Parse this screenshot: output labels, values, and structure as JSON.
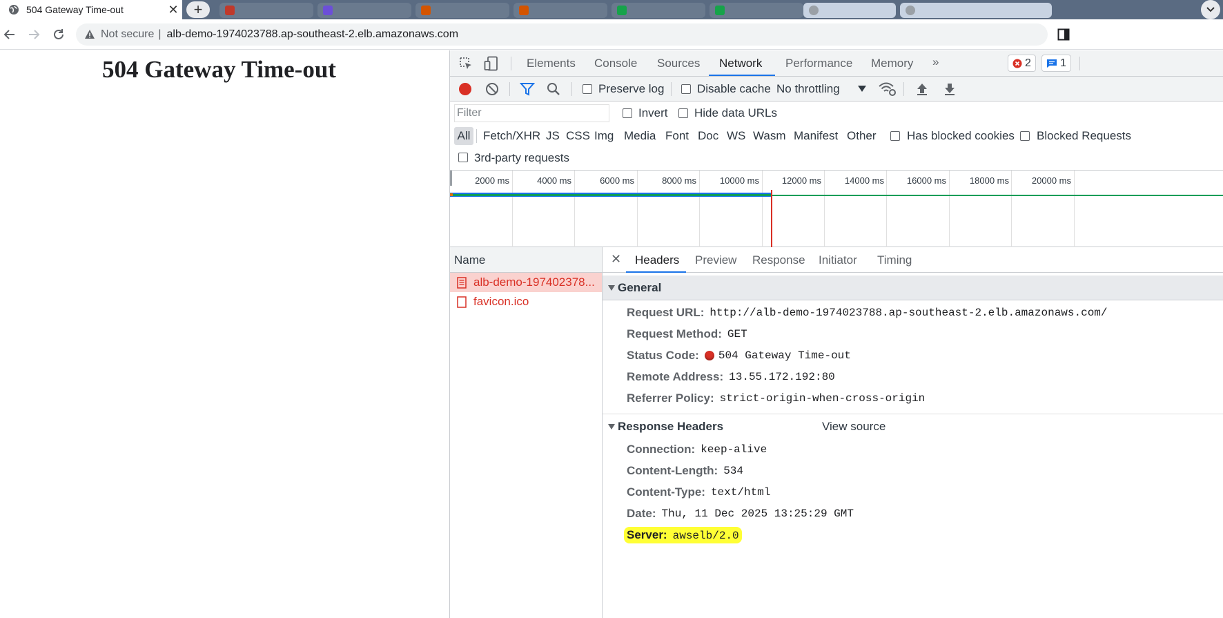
{
  "browser": {
    "active_tab_title": "504 Gateway Time-out",
    "not_secure_label": "Not secure",
    "url": "alb-demo-1974023788.ap-southeast-2.elb.amazonaws.com"
  },
  "page": {
    "heading": "504 Gateway Time-out"
  },
  "devtools": {
    "tabs": [
      "Elements",
      "Console",
      "Sources",
      "Network",
      "Performance",
      "Memory"
    ],
    "active_tab": "Network",
    "error_count": "2",
    "message_count": "1",
    "toolbar": {
      "preserve_log": "Preserve log",
      "disable_cache": "Disable cache",
      "throttling": "No throttling"
    },
    "filter": {
      "placeholder": "Filter",
      "invert": "Invert",
      "hide_data_urls": "Hide data URLs"
    },
    "type_filters": [
      "All",
      "Fetch/XHR",
      "JS",
      "CSS",
      "Img",
      "Media",
      "Font",
      "Doc",
      "WS",
      "Wasm",
      "Manifest",
      "Other"
    ],
    "has_blocked_cookies": "Has blocked cookies",
    "blocked_requests": "Blocked Requests",
    "third_party": "3rd-party requests",
    "timeline_ticks": [
      "2000 ms",
      "4000 ms",
      "6000 ms",
      "8000 ms",
      "10000 ms",
      "12000 ms",
      "14000 ms",
      "16000 ms",
      "18000 ms",
      "20000 ms"
    ],
    "request_list": {
      "header": "Name",
      "rows": [
        {
          "name": "alb-demo-197402378..."
        },
        {
          "name": "favicon.ico"
        }
      ]
    },
    "details": {
      "tabs": [
        "Headers",
        "Preview",
        "Response",
        "Initiator",
        "Timing"
      ],
      "general_title": "General",
      "general": [
        {
          "key": "Request URL:",
          "value": "http://alb-demo-1974023788.ap-southeast-2.elb.amazonaws.com/"
        },
        {
          "key": "Request Method:",
          "value": "GET"
        },
        {
          "key": "Status Code:",
          "value": "504 Gateway Time-out"
        },
        {
          "key": "Remote Address:",
          "value": "13.55.172.192:80"
        },
        {
          "key": "Referrer Policy:",
          "value": "strict-origin-when-cross-origin"
        }
      ],
      "response_headers_title": "Response Headers",
      "view_source": "View source",
      "response_headers": [
        {
          "key": "Connection:",
          "value": "keep-alive"
        },
        {
          "key": "Content-Length:",
          "value": "534"
        },
        {
          "key": "Content-Type:",
          "value": "text/html"
        },
        {
          "key": "Date:",
          "value": "Thu, 11 Dec 2025 13:25:29 GMT"
        },
        {
          "key": "Server:",
          "value": "awselb/2.0"
        }
      ]
    }
  },
  "colors": {
    "accent": "#1a73e8",
    "error": "#d93025",
    "highlight": "#ffff35",
    "timeline_green": "#0f9d58",
    "timeline_blue": "#1a73e8"
  }
}
